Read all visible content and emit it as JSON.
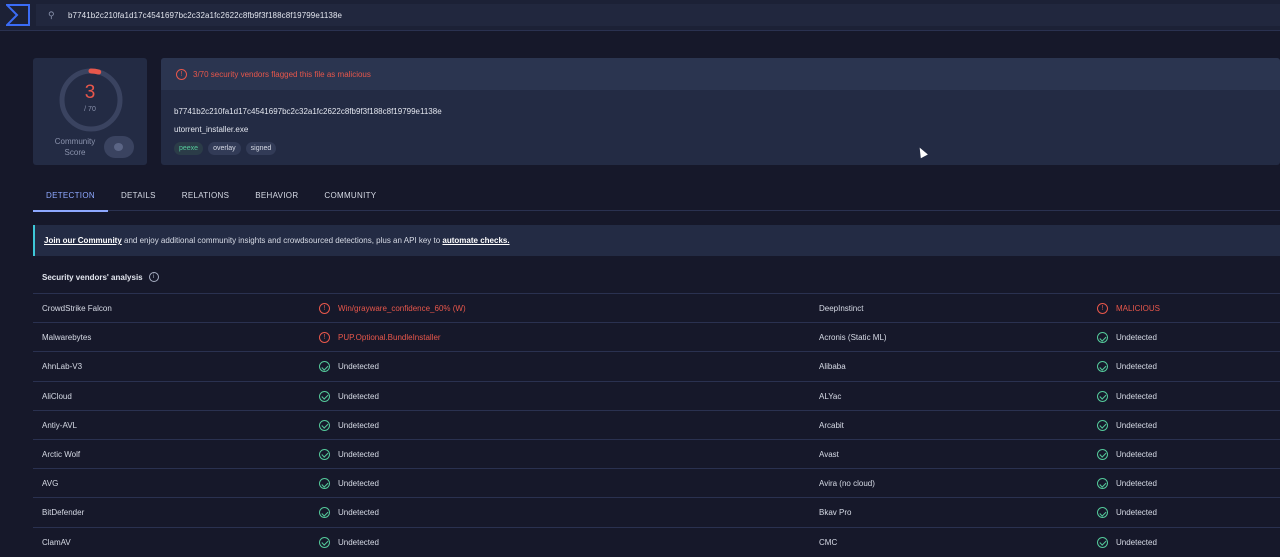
{
  "search": {
    "query": "b7741b2c210fa1d17c4541697bc2c32a1fc2622c8fb9f3f188c8f19799e1138e"
  },
  "score": {
    "value": "3",
    "total": "/ 70",
    "community_label_1": "Community",
    "community_label_2": "Score",
    "detections": 3,
    "engines": 70
  },
  "alert": {
    "text": "3/70 security vendors flagged this file as malicious"
  },
  "file": {
    "hash": "b7741b2c210fa1d17c4541697bc2c32a1fc2622c8fb9f3f188c8f19799e1138e",
    "name": "utorrent_installer.exe",
    "tags": [
      "peexe",
      "overlay",
      "signed"
    ]
  },
  "tabs": [
    "DETECTION",
    "DETAILS",
    "RELATIONS",
    "BEHAVIOR",
    "COMMUNITY"
  ],
  "banner": {
    "link1": "Join our Community",
    "middle": " and enjoy additional community insights and crowdsourced detections, plus an API key to ",
    "link2": "automate checks."
  },
  "section": {
    "title": "Security vendors' analysis"
  },
  "colors": {
    "malicious": "#e8574b",
    "clean": "#54c99a",
    "accent": "#8ea8ff"
  },
  "vendors": [
    {
      "v1": "CrowdStrike Falcon",
      "r1": "Win/grayware_confidence_60% (W)",
      "s1": "bad",
      "v2": "DeepInstinct",
      "r2": "MALICIOUS",
      "s2": "bad"
    },
    {
      "v1": "Malwarebytes",
      "r1": "PUP.Optional.BundleInstaller",
      "s1": "bad",
      "v2": "Acronis (Static ML)",
      "r2": "Undetected",
      "s2": "ok"
    },
    {
      "v1": "AhnLab-V3",
      "r1": "Undetected",
      "s1": "ok",
      "v2": "Alibaba",
      "r2": "Undetected",
      "s2": "ok"
    },
    {
      "v1": "AliCloud",
      "r1": "Undetected",
      "s1": "ok",
      "v2": "ALYac",
      "r2": "Undetected",
      "s2": "ok"
    },
    {
      "v1": "Antiy-AVL",
      "r1": "Undetected",
      "s1": "ok",
      "v2": "Arcabit",
      "r2": "Undetected",
      "s2": "ok"
    },
    {
      "v1": "Arctic Wolf",
      "r1": "Undetected",
      "s1": "ok",
      "v2": "Avast",
      "r2": "Undetected",
      "s2": "ok"
    },
    {
      "v1": "AVG",
      "r1": "Undetected",
      "s1": "ok",
      "v2": "Avira (no cloud)",
      "r2": "Undetected",
      "s2": "ok"
    },
    {
      "v1": "BitDefender",
      "r1": "Undetected",
      "s1": "ok",
      "v2": "Bkav Pro",
      "r2": "Undetected",
      "s2": "ok"
    },
    {
      "v1": "ClamAV",
      "r1": "Undetected",
      "s1": "ok",
      "v2": "CMC",
      "r2": "Undetected",
      "s2": "ok"
    }
  ]
}
